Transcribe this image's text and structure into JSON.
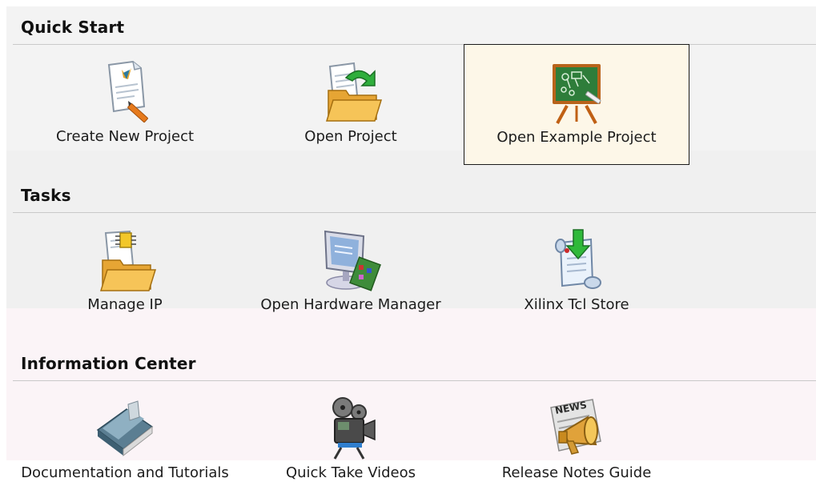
{
  "sections": [
    {
      "title": "Quick Start",
      "items": [
        {
          "label": "Create New Project",
          "icon": "new-project-icon",
          "selected": false
        },
        {
          "label": "Open Project",
          "icon": "open-project-icon",
          "selected": false
        },
        {
          "label": "Open Example Project",
          "icon": "example-project-icon",
          "selected": true
        }
      ]
    },
    {
      "title": "Tasks",
      "items": [
        {
          "label": "Manage IP",
          "icon": "manage-ip-icon",
          "selected": false
        },
        {
          "label": "Open Hardware Manager",
          "icon": "hardware-manager-icon",
          "selected": false
        },
        {
          "label": "Xilinx Tcl Store",
          "icon": "tcl-store-icon",
          "selected": false
        }
      ]
    },
    {
      "title": "Information Center",
      "items": [
        {
          "label": "Documentation and Tutorials",
          "icon": "documentation-icon",
          "selected": false
        },
        {
          "label": "Quick Take Videos",
          "icon": "video-camera-icon",
          "selected": false
        },
        {
          "label": "Release Notes Guide",
          "icon": "news-megaphone-icon",
          "selected": false
        }
      ]
    }
  ],
  "colors": {
    "selection_background": "#fdf7e8",
    "selection_border": "#1a1a1a",
    "header_rule": "#c9c9c9"
  }
}
